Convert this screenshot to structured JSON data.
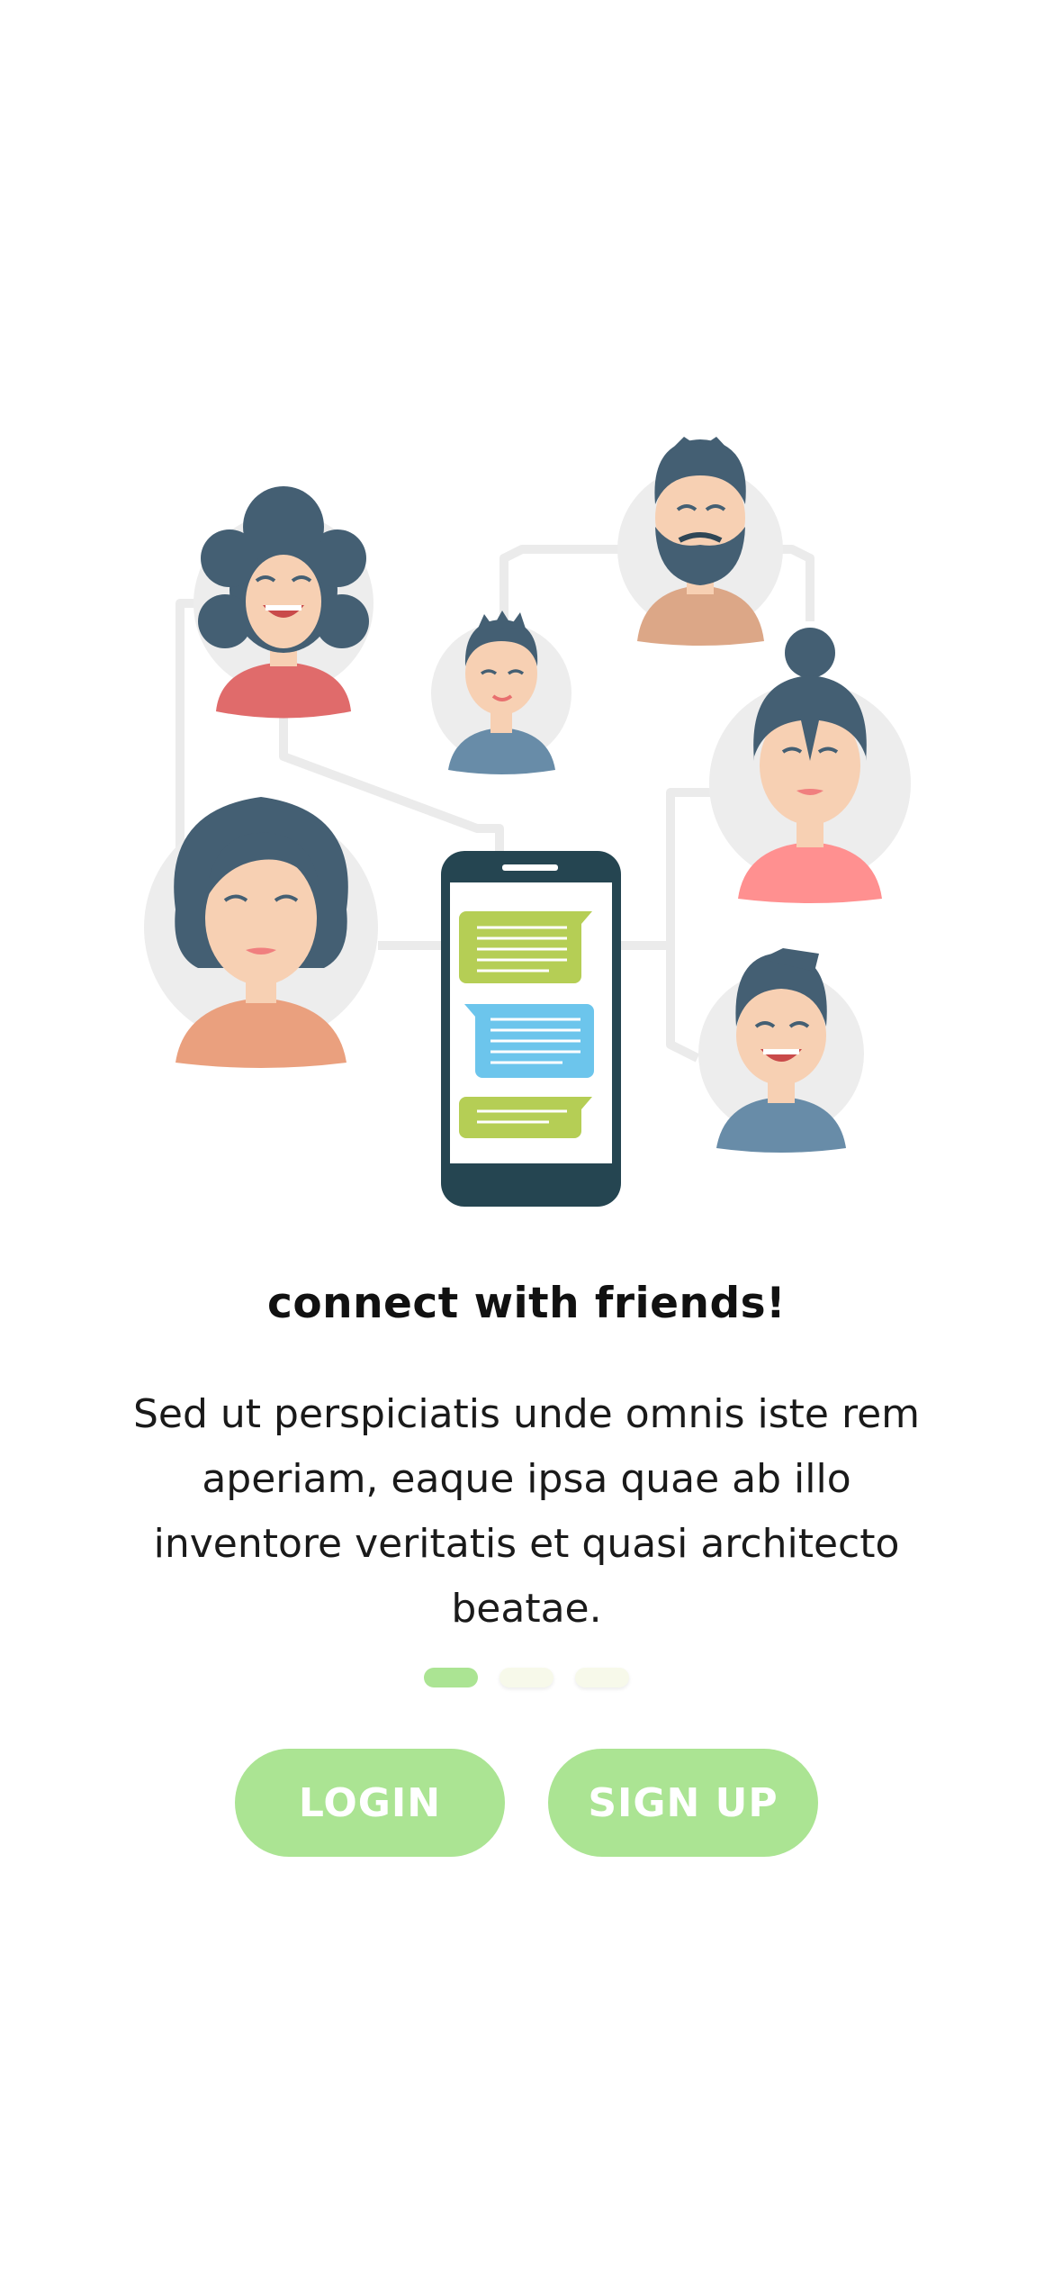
{
  "onboarding": {
    "headline": "connect with friends!",
    "body": "Sed ut perspiciatis unde omnis iste rem aperiam, eaque ipsa quae ab illo inventore veritatis et quasi architecto beatae.",
    "pages": {
      "count": 3,
      "active_index": 0
    },
    "illustration": {
      "icon": "people-network-chat-illustration",
      "avatars": [
        "woman-curly-hair-avatar",
        "boy-avatar",
        "bearded-man-avatar",
        "woman-bun-avatar",
        "woman-bob-avatar",
        "smiling-man-avatar"
      ],
      "phone": "chat-phone-icon"
    }
  },
  "actions": {
    "login_label": "LOGIN",
    "signup_label": "SIGN UP"
  },
  "colors": {
    "accent": "#abe493",
    "dot_inactive": "#f7f9ea",
    "hair": "#445f73",
    "skin": "#f7d0b3",
    "avatar_bg": "#ededed",
    "connector": "#ebebeb",
    "phone_body": "#254551",
    "bubble_green": "#b5ce55",
    "bubble_blue": "#6cc5ec",
    "shirt_red": "#e06b6b",
    "shirt_pink": "#ff9090",
    "shirt_peach": "#eaa07e",
    "shirt_tan": "#dca787",
    "shirt_blue": "#688ca8"
  }
}
